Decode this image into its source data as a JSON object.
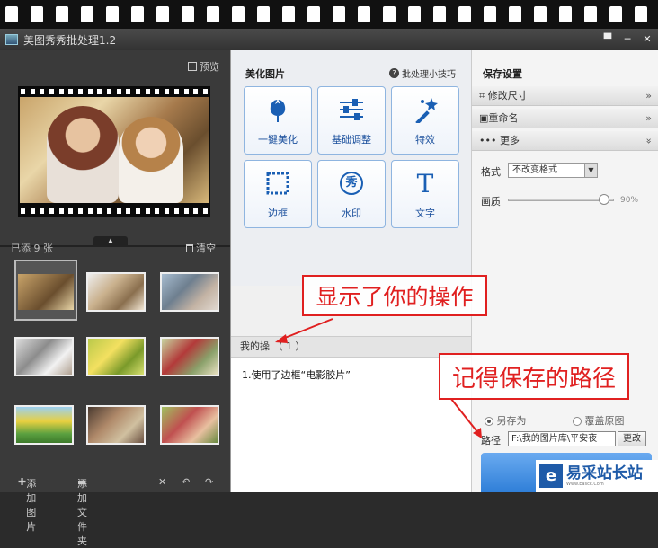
{
  "window": {
    "title": "美图秀秀批处理1.2",
    "buttons": [
      "▀",
      "─",
      "✕"
    ]
  },
  "left": {
    "preview_label": "预览",
    "added_label": "已添 9 张",
    "clear_label": "清空",
    "collapse_arrow": "▲",
    "add_image_label": "添加图片",
    "add_folder_label": "添加文件夹",
    "delete_icon": "✕",
    "rotate_left_icon": "↶",
    "rotate_right_icon": "↷"
  },
  "center": {
    "section_title": "美化图片",
    "tips_label": "批处理小技巧",
    "tips_q": "?",
    "tools": [
      {
        "label": "一键美化",
        "icon": "tulip-icon"
      },
      {
        "label": "基础调整",
        "icon": "sliders-icon"
      },
      {
        "label": "特效",
        "icon": "magic-wand-icon"
      },
      {
        "label": "边框",
        "icon": "frame-icon"
      },
      {
        "label": "水印",
        "icon": "watermark-stamp-icon"
      },
      {
        "label": "文字",
        "icon": "text-icon"
      }
    ],
    "tool_glyphs": {
      "watermark": "秀",
      "text": "T"
    },
    "ops_header": "我的操",
    "ops_count": "（ 1 ）",
    "ops_items": [
      "1.使用了边框“电影胶片”"
    ]
  },
  "annotations": {
    "ops_note": "显示了你的操作",
    "path_note": "记得保存的路径"
  },
  "right": {
    "title": "保存设置",
    "rows": [
      {
        "label": "修改尺寸",
        "chev": "»"
      },
      {
        "label": "重命名",
        "chev": "»"
      },
      {
        "label": "更多",
        "chev": "»"
      }
    ],
    "format_label": "格式",
    "format_value": "不改变格式",
    "select_arrow": "▼",
    "quality_label": "画质",
    "quality_value": "90%",
    "quality_fraction": 0.9,
    "save_as_label": "另存为",
    "overwrite_label": "覆盖原图",
    "path_label": "路径",
    "path_value": "F:\\我的图片库\\平安夜",
    "change_label": "更改"
  },
  "watermark": {
    "text": "易采站长站",
    "sub": "Www.Easck.Com"
  }
}
